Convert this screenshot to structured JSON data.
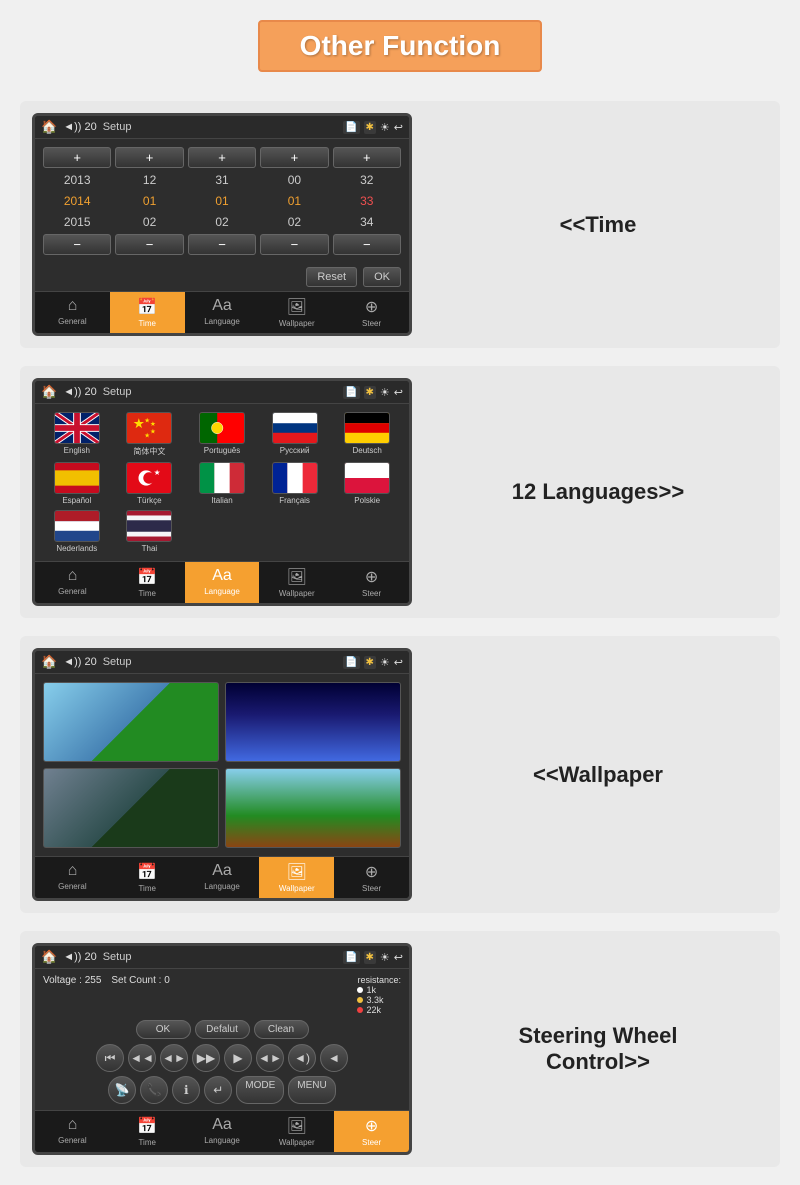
{
  "header": {
    "title": "Other Function"
  },
  "features": [
    {
      "id": "time",
      "label": "<<Time",
      "position": "right",
      "screen": "time"
    },
    {
      "id": "language",
      "label": "12 Languages>>",
      "position": "left",
      "screen": "language"
    },
    {
      "id": "wallpaper",
      "label": "<<Wallpaper",
      "position": "right",
      "screen": "wallpaper"
    },
    {
      "id": "steer",
      "label": "Steering Wheel\nControl>>",
      "position": "left",
      "screen": "steer"
    }
  ],
  "time_screen": {
    "topbar": {
      "icon": "🏠",
      "volume": "◄)) 20",
      "title": "Setup"
    },
    "cols": [
      {
        "values": [
          "2013",
          "2014",
          "2015"
        ],
        "highlight": 1
      },
      {
        "values": [
          "12",
          "01",
          "02"
        ],
        "highlight": 1
      },
      {
        "values": [
          "31",
          "01",
          "02"
        ],
        "highlight": 1
      },
      {
        "values": [
          "00",
          "01",
          "02"
        ],
        "highlight": 1
      },
      {
        "values": [
          "32",
          "33",
          "34"
        ],
        "highlight": 1,
        "color2": true
      }
    ],
    "buttons": [
      "Reset",
      "OK"
    ],
    "nav": [
      "General",
      "Time",
      "Language",
      "Wallpaper",
      "Steer"
    ],
    "active_nav": 1
  },
  "lang_screen": {
    "topbar": {
      "icon": "🏠",
      "volume": "◄)) 20",
      "title": "Setup"
    },
    "languages": [
      {
        "name": "English",
        "flag": "uk"
      },
      {
        "name": "简体中文",
        "flag": "china"
      },
      {
        "name": "Português",
        "flag": "portugal"
      },
      {
        "name": "Русский",
        "flag": "russia"
      },
      {
        "name": "Deutsch",
        "flag": "germany"
      },
      {
        "name": "Español",
        "flag": "spain"
      },
      {
        "name": "Türkçe",
        "flag": "turkey"
      },
      {
        "name": "Italian",
        "flag": "italy"
      },
      {
        "name": "Français",
        "flag": "france"
      },
      {
        "name": "Polskie",
        "flag": "poland"
      },
      {
        "name": "Nederlands",
        "flag": "netherlands"
      },
      {
        "name": "Thai",
        "flag": "thailand"
      }
    ],
    "nav": [
      "General",
      "Time",
      "Language",
      "Wallpaper",
      "Steer"
    ],
    "active_nav": 2
  },
  "wallpaper_screen": {
    "topbar": {
      "icon": "🏠",
      "volume": "◄)) 20",
      "title": "Setup"
    },
    "nav": [
      "General",
      "Time",
      "Language",
      "Wallpaper",
      "Steer"
    ],
    "active_nav": 3
  },
  "steer_screen": {
    "topbar": {
      "icon": "🏠",
      "volume": "◄)) 20",
      "title": "Setup"
    },
    "voltage": "Voltage : 255",
    "set_count": "Set Count : 0",
    "resistance_label": "resistance:",
    "resistances": [
      "1k",
      "3.3k",
      "22k"
    ],
    "buttons": [
      "OK",
      "Defalut",
      "Clean"
    ],
    "controls": [
      "⏮",
      "◄◄",
      "►◄",
      "▶▶",
      "►",
      "◄►",
      "◄)",
      "◄"
    ],
    "controls2": [
      "📡",
      "📞",
      "ℹ",
      "↵",
      "MODE",
      "MENU"
    ],
    "nav": [
      "General",
      "Time",
      "Language",
      "Wallpaper",
      "Steer"
    ],
    "active_nav": 4
  },
  "nav_icons": [
    "⌂",
    "📅",
    "Aa",
    "🖼",
    "⊕"
  ],
  "labels": {
    "time_feature": "<<Time",
    "lang_feature": "12 Languages>>",
    "wallpaper_feature": "<<Wallpaper",
    "steer_feature_line1": "Steering Wheel",
    "steer_feature_line2": "Control>>"
  }
}
